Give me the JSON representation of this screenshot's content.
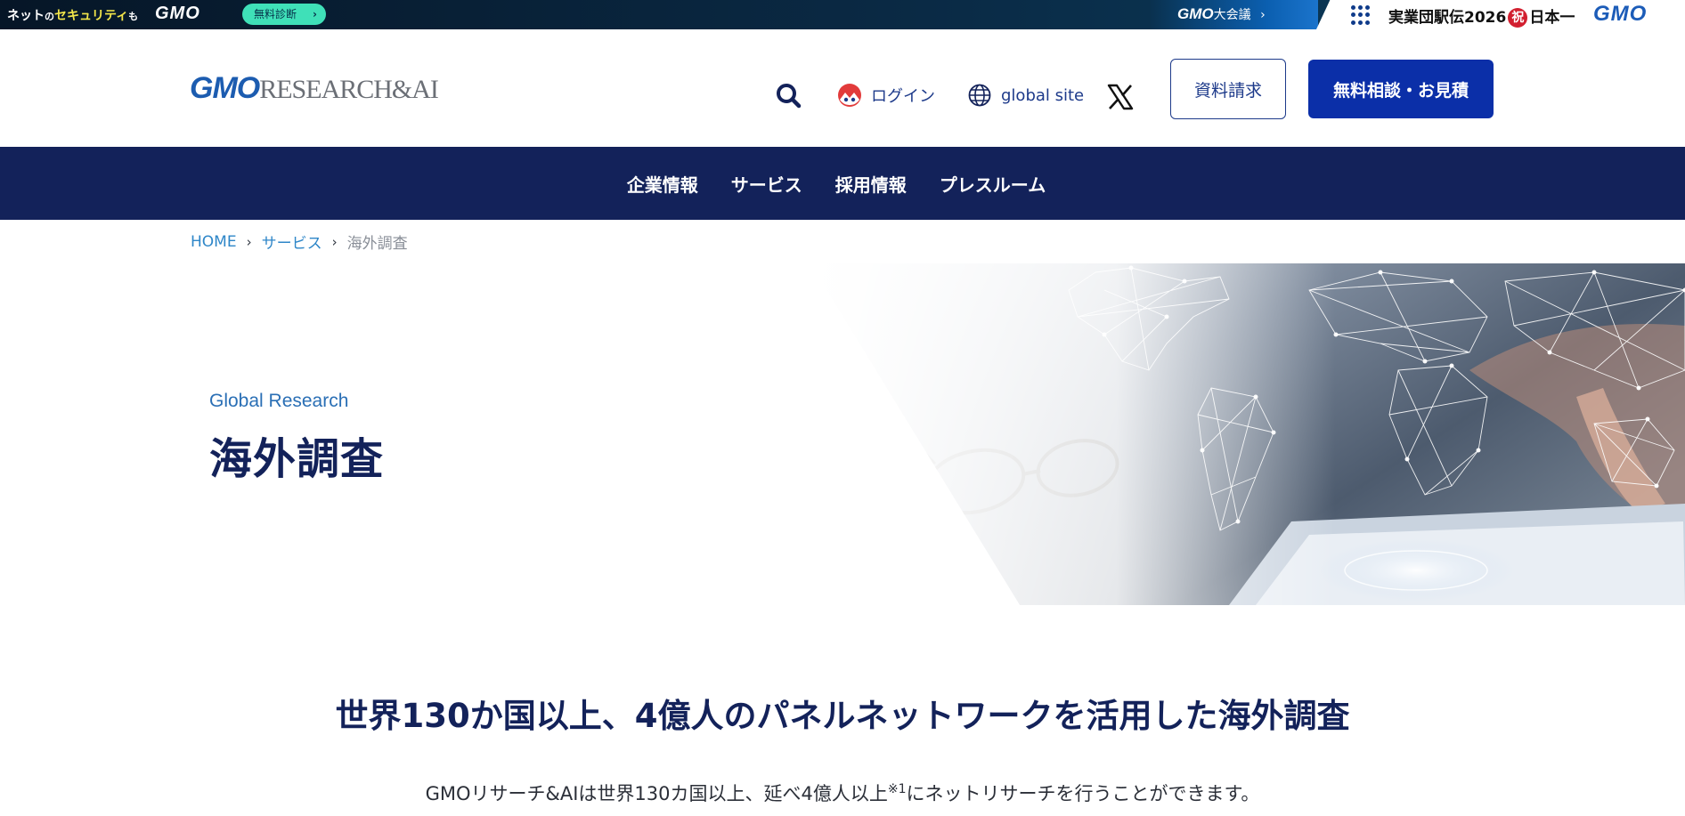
{
  "topbar": {
    "net_prefix": "ネット",
    "net_no": "の",
    "net_security": "セキュリティ",
    "net_mo": "も",
    "gmo_logo": "GMO",
    "diagnosis_label": "無料診断",
    "diagnosis_chevron": "›",
    "conference_gmo": "GMO",
    "conference_label": "大会議",
    "conference_chevron": "›",
    "ekiden_prefix": "実業団駅伝2026",
    "ekiden_iwai": "祝",
    "ekiden_suffix": "日本一",
    "gmo_logo_right": "GMO",
    "colors": {
      "security": "#f3e64a",
      "diagnosis_bg": "#3fe0b8",
      "gmo_blue": "#1c5cb8"
    }
  },
  "header": {
    "logo_gmo": "GMO",
    "logo_rest": "RESEARCH&AI",
    "login_label": "ログイン",
    "global_label": "global site",
    "doc_request_label": "資料請求",
    "consult_label": "無料相談・お見積",
    "icons": [
      "search-icon",
      "login-avatar-icon",
      "globe-icon",
      "x-logo-icon"
    ],
    "colors": {
      "brand_navy": "#13225a",
      "cta_blue": "#0b2fa8"
    }
  },
  "nav": {
    "items": [
      {
        "label": "企業情報"
      },
      {
        "label": "サービス"
      },
      {
        "label": "採用情報"
      },
      {
        "label": "プレスルーム"
      }
    ]
  },
  "breadcrumb": {
    "home": "HOME",
    "services": "サービス",
    "current": "海外調査",
    "separator": "›"
  },
  "hero": {
    "eyebrow": "Global Research",
    "title": "海外調査"
  },
  "content": {
    "lead_title": "世界130か国以上、4億人のパネルネットワークを活用した海外調査",
    "lead_text_before": "GMOリサーチ&AIは世界130カ国以上、延べ4億人以上",
    "lead_text_note": "※1",
    "lead_text_after": "にネットリサーチを行うことができます。"
  }
}
